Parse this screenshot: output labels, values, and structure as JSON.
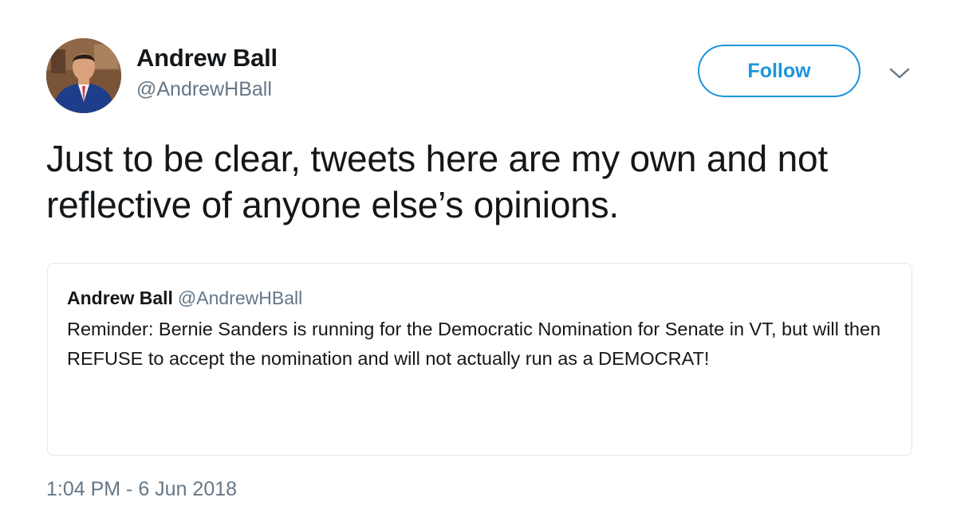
{
  "tweet": {
    "author": {
      "name": "Andrew Ball",
      "handle": "@AndrewHBall"
    },
    "follow_label": "Follow",
    "text": "Just to be clear, tweets here are my own and not reflective of anyone else’s opinions.",
    "timestamp": "1:04 PM - 6 Jun 2018"
  },
  "quoted_tweet": {
    "author": {
      "name": "Andrew Ball",
      "handle": "@AndrewHBall"
    },
    "text": "Reminder: Bernie Sanders is running for the Democratic Nomination for Senate in VT, but will then REFUSE to accept the nomination and will not actually run as a DEMOCRAT!"
  },
  "icons": {
    "menu": "chevron-down-icon",
    "avatar": "profile-photo"
  },
  "colors": {
    "accent": "#1b95e0",
    "secondary_text": "#657786",
    "primary_text": "#14171a",
    "border": "#e1e8ed"
  }
}
